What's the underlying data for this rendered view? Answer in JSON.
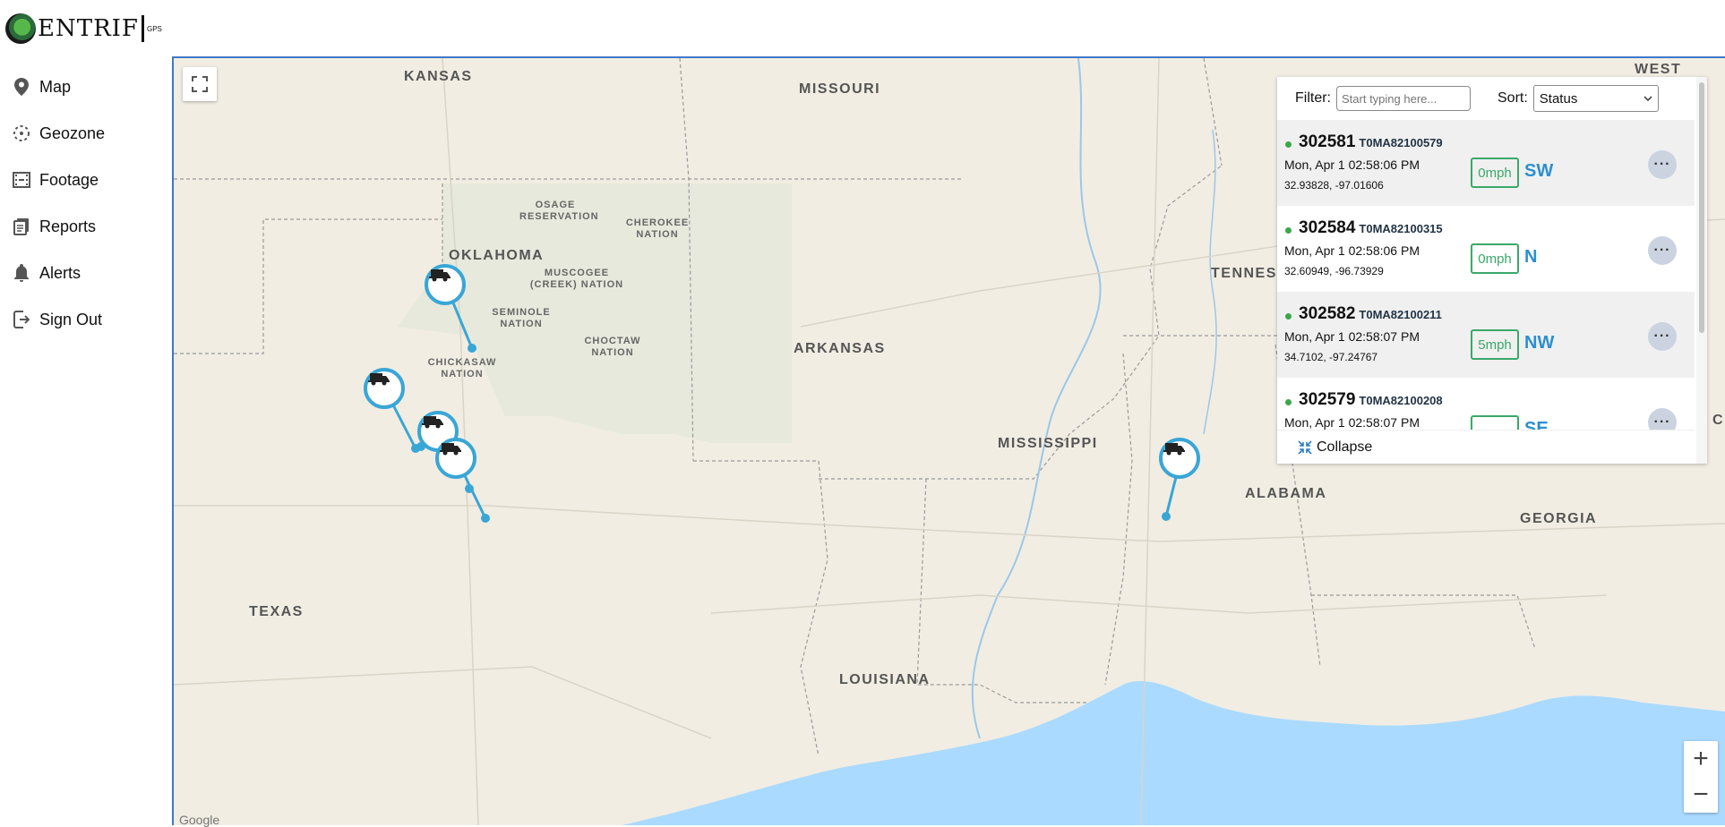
{
  "brand": {
    "name": "ENTRIF",
    "suffix": "GPS"
  },
  "nav": [
    {
      "label": "Map",
      "icon": "map-pin-icon"
    },
    {
      "label": "Geozone",
      "icon": "geozone-icon"
    },
    {
      "label": "Footage",
      "icon": "film-icon"
    },
    {
      "label": "Reports",
      "icon": "reports-icon"
    },
    {
      "label": "Alerts",
      "icon": "bell-icon"
    },
    {
      "label": "Sign Out",
      "icon": "sign-out-icon"
    }
  ],
  "map": {
    "labels": {
      "kansas": "KANSAS",
      "missouri": "MISSOURI",
      "west": "WEST",
      "oklahoma": "OKLAHOMA",
      "arkansas": "ARKANSAS",
      "tennessee": "TENNES",
      "mississippi": "MISSISSIPPI",
      "alabama": "ALABAMA",
      "georgia": "GEORGIA",
      "texas": "TEXAS",
      "louisiana": "LOUISIANA",
      "edge_c": "C"
    },
    "small_labels": {
      "osage": "OSAGE RESERVATION",
      "cherokee": "CHEROKEE NATION",
      "muscogee": "MUSCOGEE (CREEK) NATION",
      "seminole": "SEMINOLE NATION",
      "choctaw": "CHOCTAW NATION",
      "chickasaw": "CHICKASAW NATION"
    },
    "zoom_in": "+",
    "zoom_out": "−",
    "attribution": "Google"
  },
  "panel": {
    "filter_label": "Filter:",
    "filter_placeholder": "Start typing here...",
    "sort_label": "Sort:",
    "sort_value": "Status",
    "collapse_label": "Collapse",
    "more_label": "···",
    "vehicles": [
      {
        "id": "302581",
        "serial": "T0MA82100579",
        "time": "Mon, Apr 1 02:58:06 PM",
        "coords": "32.93828, -97.01606",
        "speed": "0mph",
        "heading": "SW"
      },
      {
        "id": "302584",
        "serial": "T0MA82100315",
        "time": "Mon, Apr 1 02:58:06 PM",
        "coords": "32.60949, -96.73929",
        "speed": "0mph",
        "heading": "N"
      },
      {
        "id": "302582",
        "serial": "T0MA82100211",
        "time": "Mon, Apr 1 02:58:07 PM",
        "coords": "34.7102, -97.24767",
        "speed": "5mph",
        "heading": "NW"
      },
      {
        "id": "302579",
        "serial": "T0MA82100208",
        "time": "Mon, Apr 1 02:58:07 PM",
        "coords": "",
        "speed": "",
        "heading": "SE"
      }
    ]
  }
}
